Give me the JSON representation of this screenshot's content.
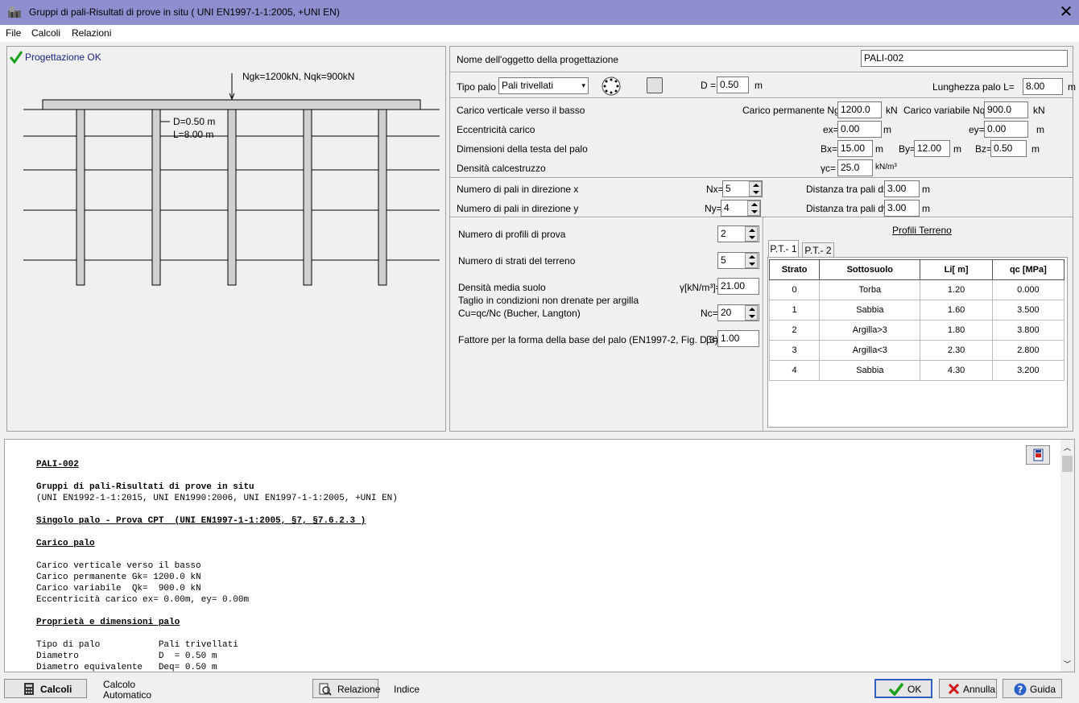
{
  "window": {
    "title": "Gruppi di pali-Risultati di prove in situ ( UNI EN1997-1-1:2005, +UNI EN)",
    "close": "✕"
  },
  "menu": {
    "file": "File",
    "calcoli": "Calcoli",
    "relazioni": "Relazioni"
  },
  "drawing": {
    "status": "Progettazione OK",
    "load_label": "Ngk=1200kN, Nqk=900kN",
    "d_label": "D=0.50 m",
    "l_label": "L=8.00 m"
  },
  "form": {
    "object_name_label": "Nome dell'oggetto della progettazione",
    "object_name": "PALI-002",
    "pile_type_label": "Tipo palo",
    "pile_type": "Pali trivellati",
    "d_label": "D =",
    "d_value": "0.50",
    "d_unit": "m",
    "length_label": "Lunghezza palo L=",
    "length_value": "8.00",
    "length_unit": "m",
    "vertical_load_label": "Carico verticale verso il basso",
    "perm_label": "Carico permanente Ng,k",
    "perm_value": "1200.0",
    "perm_unit": "kN",
    "var_label": "Carico variabile Nq,k",
    "var_value": "900.0",
    "var_unit": "kN",
    "ecc_label": "Eccentricità carico",
    "ex_label": "ex=",
    "ex_value": "0.00",
    "ex_unit": "m",
    "ey_label": "ey=",
    "ey_value": "0.00",
    "ey_unit": "m",
    "head_dims_label": "Dimensioni della testa del palo",
    "bx_label": "Bx=",
    "bx_value": "15.00",
    "bx_unit": "m",
    "by_label": "By=",
    "by_value": "12.00",
    "by_unit": "m",
    "bz_label": "Bz=",
    "bz_value": "0.50",
    "bz_unit": "m",
    "density_label": "Densità calcestruzzo",
    "gc_label": "γc=",
    "gc_value": "25.0",
    "gc_unit": "kN/m³",
    "nx_label_long": "Numero di pali in direzione x",
    "nx_label": "Nx=",
    "nx_value": "5",
    "dx_label": "Distanza tra pali dx=",
    "dx_value": "3.00",
    "dx_unit": "m",
    "ny_label_long": "Numero di pali in direzione y",
    "ny_label": "Ny=",
    "ny_value": "4",
    "dy_label": "Distanza tra pali dy=",
    "dy_value": "3.00",
    "dy_unit": "m"
  },
  "soil": {
    "profiles_label": "Numero di profili di prova",
    "profiles_value": "2",
    "layers_label": "Numero di strati del terreno",
    "layers_value": "5",
    "density_label": "Densità media suolo",
    "gamma_label": "γ[kN/m³]=",
    "gamma_value": "21.00",
    "cu_label1": "Taglio in condizioni non drenate per argilla",
    "cu_label2": "Cu=qc/Nc (Bucher, Langton)",
    "nc_label": "Nc=",
    "nc_value": "20",
    "beta_text": "Fattore per la forma della base del palo (EN1997-2, Fig. D.3)",
    "beta_label": "β=",
    "beta_value": "1.00",
    "profiles_title": "Profili Terreno",
    "tabs": [
      "P.T.- 1",
      "P.T.- 2"
    ],
    "columns": [
      "Strato",
      "Sottosuolo",
      "Li[ m]",
      "qc [MPa]"
    ],
    "rows": [
      [
        "0",
        "Torba",
        "1.20",
        "0.000"
      ],
      [
        "1",
        "Sabbia",
        "1.60",
        "3.500"
      ],
      [
        "2",
        "Argilla>3",
        "1.80",
        "3.800"
      ],
      [
        "3",
        "Argilla<3",
        "2.30",
        "2.800"
      ],
      [
        "4",
        "Sabbia",
        "4.30",
        "3.200"
      ]
    ]
  },
  "report": {
    "l1": "PALI-002",
    "l2": "Gruppi di pali-Risultati di prove in situ",
    "l3": "(UNI EN1992-1-1:2015, UNI EN1990:2006, UNI EN1997-1-1:2005, +UNI EN)",
    "l4": "Singolo palo - Prova CPT  (UNI EN1997-1-1:2005, §7, §7.6.2.3 )",
    "l5": "Carico palo",
    "l6": "Carico verticale verso il basso",
    "l7": "Carico permanente Gk= 1200.0 kN",
    "l8": "Carico variabile  Qk=  900.0 kN",
    "l9": "Eccentricità carico ex= 0.00m, ey= 0.00m",
    "l10": "Proprietà e dimensioni palo",
    "l11": "Tipo di palo           Pali trivellati",
    "l12": "Diametro               D  = 0.50 m",
    "l13": "Diametro equivalente   Deq= 0.50 m"
  },
  "bottom": {
    "calcoli": "Calcoli",
    "auto1": "Calcolo",
    "auto2": "Automatico",
    "relazione": "Relazione",
    "indice": "Indice",
    "ok": "OK",
    "annulla": "Annulla",
    "guida": "Guida"
  }
}
